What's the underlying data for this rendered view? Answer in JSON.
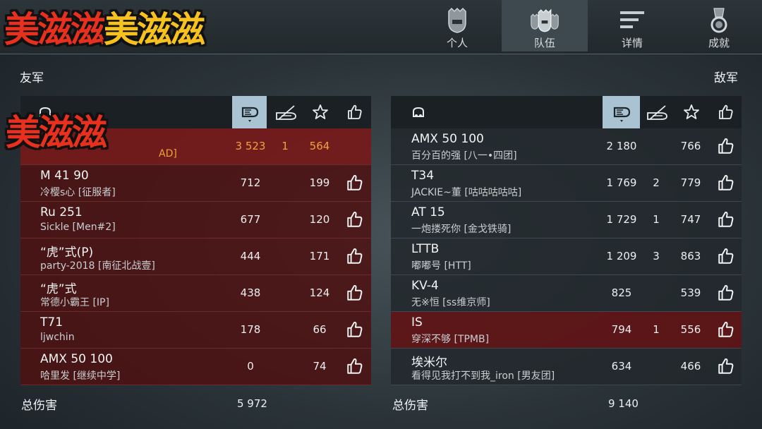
{
  "tabs": [
    {
      "label": "个人",
      "icon": "personal-helmet-icon"
    },
    {
      "label": "队伍",
      "icon": "team-helmets-icon"
    },
    {
      "label": "详情",
      "icon": "details-list-icon"
    },
    {
      "label": "成就",
      "icon": "achievement-medal-icon"
    }
  ],
  "sticker_text": "美滋滋",
  "ally": {
    "title": "友军",
    "rows": [
      {
        "tank": "",
        "player": "AD]",
        "damage": "3 523",
        "kills": "1",
        "exp": "564",
        "like": false,
        "highlight": true
      },
      {
        "tank": "M 41 90",
        "player": "冷樱s心 [征服者]",
        "damage": "712",
        "kills": "",
        "exp": "199",
        "like": true
      },
      {
        "tank": "Ru 251",
        "player": "Sickle [Men#2]",
        "damage": "677",
        "kills": "",
        "exp": "120",
        "like": true
      },
      {
        "tank": "“虎”式(P)",
        "player": "party-2018 [南征北战壹]",
        "damage": "444",
        "kills": "",
        "exp": "171",
        "like": true
      },
      {
        "tank": "“虎”式",
        "player": "常德小霸王 [IP]",
        "damage": "438",
        "kills": "",
        "exp": "124",
        "like": true
      },
      {
        "tank": "T71",
        "player": "ljwchin",
        "damage": "178",
        "kills": "",
        "exp": "66",
        "like": true
      },
      {
        "tank": "AMX 50 100",
        "player": "哈里发 [继续中学]",
        "damage": "0",
        "kills": "",
        "exp": "74",
        "like": true
      }
    ],
    "total_label": "总伤害",
    "total": "5 972"
  },
  "enemy": {
    "title": "敌军",
    "rows": [
      {
        "tank": "AMX 50 100",
        "player": "百分百的强 [八一•四团]",
        "damage": "2 180",
        "kills": "",
        "exp": "766",
        "like": true
      },
      {
        "tank": "T34",
        "player": "JACKIE~董 [咕咕咕咕咕]",
        "damage": "1 769",
        "kills": "2",
        "exp": "779",
        "like": true
      },
      {
        "tank": "AT 15",
        "player": "一炮搂死你 [金戈铁骑]",
        "damage": "1 729",
        "kills": "1",
        "exp": "747",
        "like": true
      },
      {
        "tank": "LTTB",
        "player": "嘟嘟号 [HTT]",
        "damage": "1 209",
        "kills": "3",
        "exp": "863",
        "like": true
      },
      {
        "tank": "KV-4",
        "player": "无※恒 [ss维京师]",
        "damage": "825",
        "kills": "",
        "exp": "539",
        "like": true
      },
      {
        "tank": "IS",
        "player": "穿深不够 [TPMB]",
        "damage": "794",
        "kills": "1",
        "exp": "556",
        "like": true,
        "highlight": true
      },
      {
        "tank": "埃米尔",
        "player": "看得见我打不到我_iron [男友团]",
        "damage": "634",
        "kills": "",
        "exp": "466",
        "like": true
      }
    ],
    "total_label": "总伤害",
    "total": "9 140"
  },
  "colors": {
    "accent_orange": "#f0a23a",
    "ally_row": "#4e1212",
    "selected_column": "#a9c3d2"
  }
}
